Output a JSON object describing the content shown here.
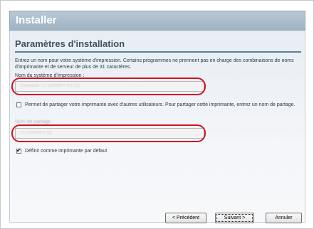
{
  "window": {
    "title": "Installer"
  },
  "section": {
    "heading": "Paramètres d'installation",
    "description": "Entrez un nom pour votre système d'impression. Certains programmes ne prennent pas en charge des combinaisons de noms d'imprimante et de serveur de plus de 31 caractères."
  },
  "printer_name": {
    "label": "Nom du système d'impression :",
    "value": "Nomvalue-TC-2040MFP KX (2)"
  },
  "share": {
    "checkbox_checked": false,
    "checkbox_label": "Permet de partager votre imprimante avec d'autres utilisateurs. Pour partager cette imprimante, entrez un nom de partage.",
    "name_label": "Nom de partage :",
    "name_value": "TC-2040MFP (1)"
  },
  "default_printer": {
    "checkbox_checked": true,
    "label": "Définir comme imprimante par défaut"
  },
  "buttons": {
    "back": "< Précédent",
    "next": "Suivant >",
    "cancel": "Annuler"
  },
  "colors": {
    "annotation": "#d0141e",
    "accent": "#5b7fa0"
  }
}
